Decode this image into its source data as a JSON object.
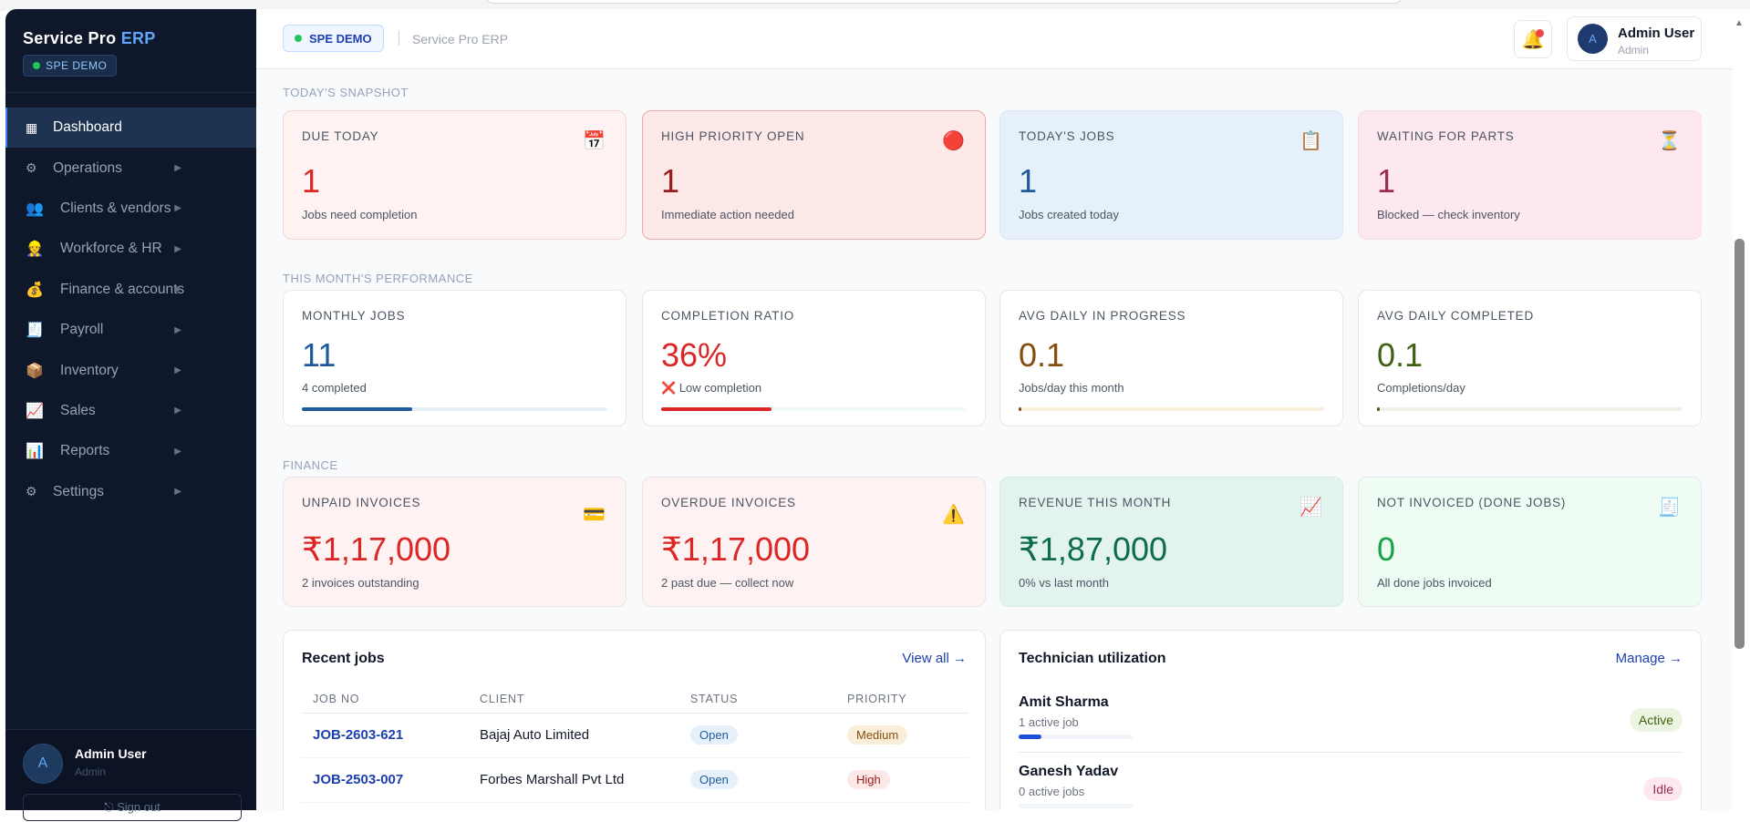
{
  "sidebar": {
    "brand": "Service Pro",
    "brand_accent": "ERP",
    "badge": "SPE DEMO",
    "items": [
      {
        "label": "Dashboard",
        "icon": "▦",
        "active": true
      },
      {
        "label": "Operations",
        "icon": "⚙"
      },
      {
        "label": "Clients & vendors",
        "icon": "👥"
      },
      {
        "label": "Workforce & HR",
        "icon": "👷"
      },
      {
        "label": "Finance & accounts",
        "icon": "💰"
      },
      {
        "label": "Payroll",
        "icon": "🧾"
      },
      {
        "label": "Inventory",
        "icon": "📦"
      },
      {
        "label": "Sales",
        "icon": "📈"
      },
      {
        "label": "Reports",
        "icon": "📊"
      },
      {
        "label": "Settings",
        "icon": "⚙"
      }
    ],
    "expand_icon": "▶",
    "user": {
      "initial": "A",
      "name": "Admin User",
      "role": "Admin"
    },
    "signout": "⎋ Sign out"
  },
  "header": {
    "badge": "SPE DEMO",
    "subtitle": "Service Pro ERP",
    "bell_icon": "🔔",
    "user": {
      "initial": "A",
      "name": "Admin User",
      "role": "Admin"
    }
  },
  "sections": {
    "snapshot": "TODAY'S SNAPSHOT",
    "performance": "THIS MONTH'S PERFORMANCE",
    "finance": "FINANCE"
  },
  "snapshot": [
    {
      "label": "DUE TODAY",
      "icon": "📅",
      "value": "1",
      "sub": "Jobs need completion"
    },
    {
      "label": "HIGH PRIORITY OPEN",
      "icon": "🔴",
      "value": "1",
      "sub": "Immediate action needed"
    },
    {
      "label": "TODAY'S JOBS",
      "icon": "📋",
      "value": "1",
      "sub": "Jobs created today"
    },
    {
      "label": "WAITING FOR PARTS",
      "icon": "⏳",
      "value": "1",
      "sub": "Blocked — check inventory"
    }
  ],
  "performance": [
    {
      "label": "MONTHLY JOBS",
      "value": "11",
      "sub": "4 completed",
      "progress": 0.36
    },
    {
      "label": "COMPLETION RATIO",
      "value": "36%",
      "sub_icon": "❌",
      "sub": "Low completion",
      "progress": 0.36
    },
    {
      "label": "AVG DAILY IN PROGRESS",
      "value": "0.1",
      "sub": "Jobs/day this month",
      "progress": 0.01
    },
    {
      "label": "AVG DAILY COMPLETED",
      "value": "0.1",
      "sub": "Completions/day",
      "progress": 0.01
    }
  ],
  "finance": [
    {
      "label": "UNPAID INVOICES",
      "icon": "💳",
      "value": "₹1,17,000",
      "sub": "2 invoices outstanding"
    },
    {
      "label": "OVERDUE INVOICES",
      "icon": "⚠️",
      "value": "₹1,17,000",
      "sub": "2 past due — collect now"
    },
    {
      "label": "REVENUE THIS MONTH",
      "icon": "📈",
      "value": "₹1,87,000",
      "sub": "0% vs last month"
    },
    {
      "label": "NOT INVOICED (DONE JOBS)",
      "icon": "🧾",
      "value": "0",
      "sub": "All done jobs invoiced"
    }
  ],
  "recent_jobs": {
    "title": "Recent jobs",
    "link": "View all →",
    "columns": [
      "JOB NO",
      "CLIENT",
      "STATUS",
      "PRIORITY"
    ],
    "rows": [
      {
        "job": "JOB-2603-621",
        "client": "Bajaj Auto Limited",
        "status": "Open",
        "priority": "Medium"
      },
      {
        "job": "JOB-2503-007",
        "client": "Forbes Marshall Pvt Ltd",
        "status": "Open",
        "priority": "High"
      }
    ]
  },
  "technicians": {
    "title": "Technician utilization",
    "link": "Manage →",
    "items": [
      {
        "name": "Amit Sharma",
        "jobs": "1 active job",
        "status": "Active",
        "utilization": 0.2
      },
      {
        "name": "Ganesh Yadav",
        "jobs": "0 active jobs",
        "status": "Idle",
        "utilization": 0
      }
    ]
  }
}
